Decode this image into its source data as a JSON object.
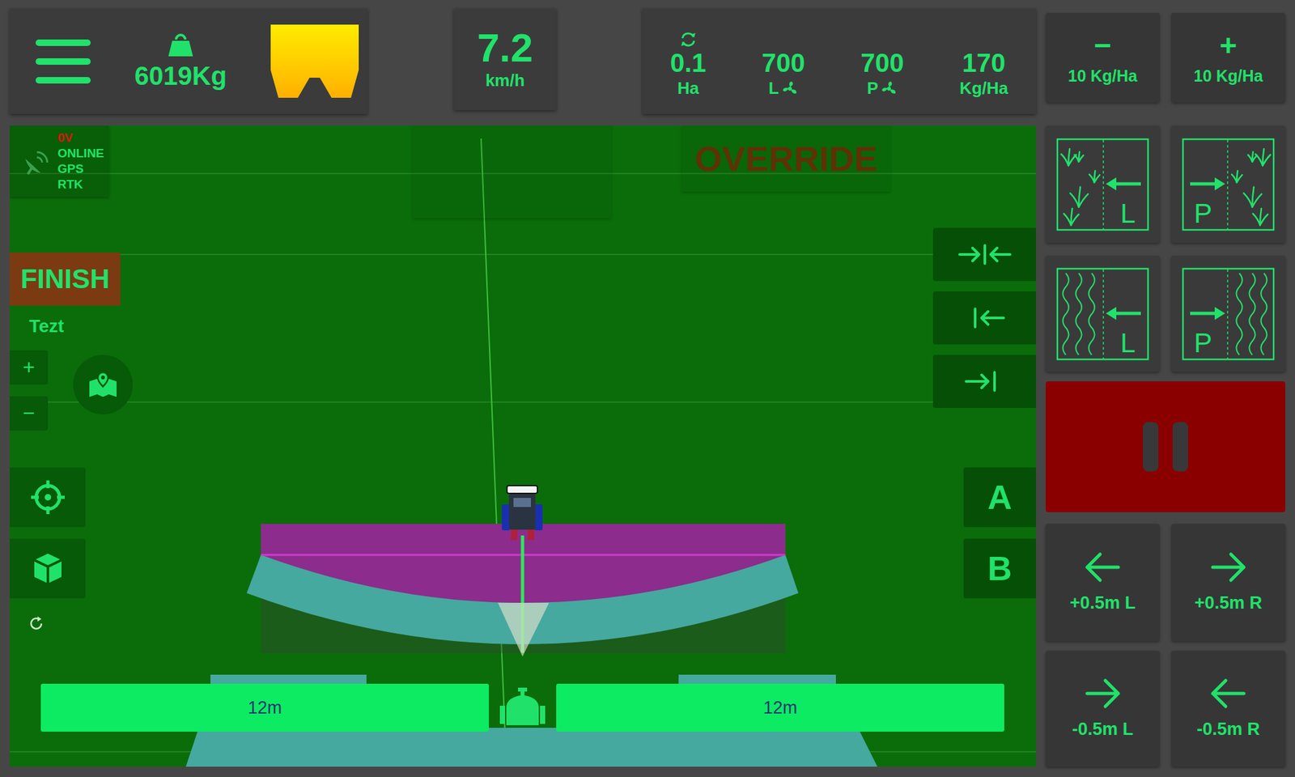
{
  "top_bar": {
    "weight": "6019Kg",
    "hopper": {
      "level": 1
    },
    "speed": {
      "value": "7.2",
      "unit": "km/h"
    },
    "stats": [
      {
        "value": "0.1",
        "label": "Ha",
        "kind": "area"
      },
      {
        "value": "700",
        "label": "L",
        "kind": "spinner"
      },
      {
        "value": "700",
        "label": "P",
        "kind": "spinner"
      },
      {
        "value": "170",
        "label": "Kg/Ha",
        "kind": "rate"
      }
    ]
  },
  "rate_buttons": [
    {
      "sign": "−",
      "label": "10 Kg/Ha"
    },
    {
      "sign": "+",
      "label": "10 Kg/Ha"
    }
  ],
  "border_buttons": [
    {
      "letter": "L",
      "kind": "grass-left"
    },
    {
      "letter": "P",
      "kind": "grass-right"
    },
    {
      "letter": "L",
      "kind": "wave-left"
    },
    {
      "letter": "P",
      "kind": "wave-right"
    }
  ],
  "pause_button": {
    "on": true
  },
  "width_buttons": [
    {
      "label": "+0.5m L",
      "kind": "left"
    },
    {
      "label": "+0.5m R",
      "kind": "right"
    },
    {
      "label": "-0.5m L",
      "kind": "right"
    },
    {
      "label": "-0.5m R",
      "kind": "left"
    }
  ],
  "map": {
    "status": [
      {
        "text": "0V",
        "color": "#e01010"
      },
      {
        "text": "ONLINE",
        "color": "#20e26a"
      },
      {
        "text": "GPS",
        "color": "#20e26a"
      },
      {
        "text": "RTK",
        "color": "#20e26a"
      }
    ],
    "finish": "FINISH",
    "field_name": "Tezt",
    "zoom": [
      "+",
      "−"
    ],
    "override": "OVERRIDE",
    "guidance_buttons": [
      {
        "kind": "center"
      },
      {
        "kind": "right-edge"
      },
      {
        "kind": "left-edge"
      }
    ],
    "ab_buttons": [
      "A",
      "B"
    ],
    "boom_sections": [
      {
        "label": "12m",
        "on": true
      },
      {
        "label": "12m",
        "on": true
      }
    ],
    "valve": {
      "open": true
    }
  }
}
